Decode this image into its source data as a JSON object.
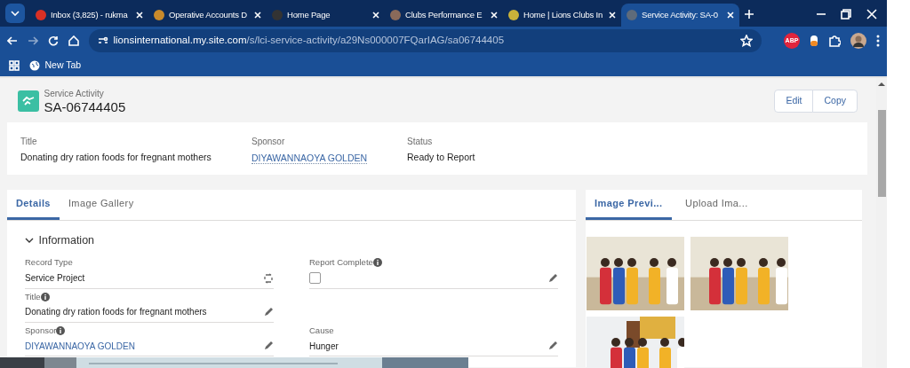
{
  "browser": {
    "tabs": [
      {
        "title": "Inbox (3,825) - rukma",
        "selected": false,
        "color": "#d93025"
      },
      {
        "title": "Operative Accounts D",
        "selected": false,
        "color": "#c98a2b"
      },
      {
        "title": "Home Page",
        "selected": false,
        "color": "#333333"
      },
      {
        "title": "Clubs Performance E",
        "selected": false,
        "color": "#8a6a5a"
      },
      {
        "title": "Home | Lions Clubs In",
        "selected": false,
        "color": "#c9b23a"
      },
      {
        "title": "Service Activity: SA-0",
        "selected": true,
        "color": "#5f6b7a"
      }
    ],
    "url_host": "lionsinternational.my.site.com",
    "url_path": "/s/lci-service-activity/a29Ns000007FQarIAG/sa06744405",
    "extension_badge": "ABP",
    "bookmarks": [
      {
        "label": "New Tab"
      }
    ]
  },
  "record": {
    "type_label": "Service Activity",
    "name": "SA-06744405",
    "actions": [
      "Edit",
      "Copy"
    ]
  },
  "highlights": [
    {
      "label": "Title",
      "value": "Donating dry ration foods for fregnant mothers",
      "kind": "text"
    },
    {
      "label": "Sponsor",
      "value": "DIYAWANNAOYA GOLDEN",
      "kind": "link"
    },
    {
      "label": "Status",
      "value": "Ready to Report",
      "kind": "text"
    }
  ],
  "detail_tabs": [
    {
      "label": "Details",
      "selected": true
    },
    {
      "label": "Image Gallery",
      "selected": false
    }
  ],
  "section": {
    "title": "Information",
    "expanded": true
  },
  "field_rows": [
    {
      "cells": [
        {
          "label": "Record Type",
          "value": "Service Project",
          "kind": "text",
          "info": false,
          "action": {
            "kind": "change"
          }
        },
        {
          "label": "Report Complete",
          "kind": "checkbox",
          "checked": false,
          "info": true,
          "action": {
            "kind": "edit"
          }
        }
      ]
    },
    {
      "cells": [
        {
          "label": "Title",
          "value": "Donating dry ration foods for fregnant mothers",
          "kind": "text",
          "info": true,
          "action": {
            "kind": "edit"
          }
        }
      ]
    },
    {
      "cells": [
        {
          "label": "Sponsor",
          "value": "DIYAWANNAOYA GOLDEN",
          "kind": "link",
          "info": true,
          "action": {
            "kind": "edit"
          }
        },
        {
          "label": "Cause",
          "value": "Hunger",
          "kind": "text",
          "info": false,
          "action": {
            "kind": "edit"
          }
        }
      ]
    }
  ],
  "preview_tabs": [
    {
      "label": "Image Previ...",
      "selected": true
    },
    {
      "label": "Upload Ima...",
      "selected": false
    }
  ]
}
